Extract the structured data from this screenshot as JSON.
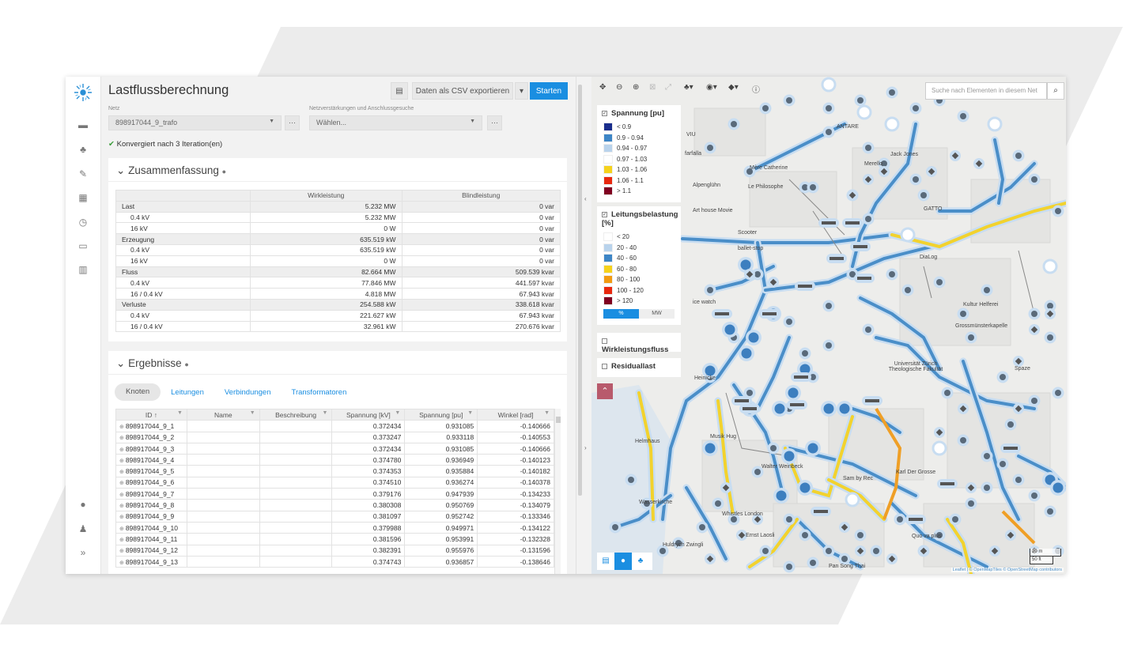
{
  "app": {
    "title": "Lastflussberechnung"
  },
  "toolbar": {
    "export_label": "Daten als CSV exportieren",
    "start_label": "Starten"
  },
  "net": {
    "label": "Netz",
    "value": "898917044_9_trafo"
  },
  "reinforcement": {
    "label": "Netzverstärkungen und Anschlussgesuche",
    "placeholder": "Wählen..."
  },
  "status": {
    "text": "Konvergiert nach 3 Iteration(en)"
  },
  "summary": {
    "title": "Zusammenfassung",
    "headers": [
      "",
      "Wirkleistung",
      "Blindleistung"
    ],
    "rows": [
      {
        "label": "Last",
        "wirk": "5.232 MW",
        "blind": "0 var",
        "group": true
      },
      {
        "label": "0.4 kV",
        "wirk": "5.232 MW",
        "blind": "0 var"
      },
      {
        "label": "16 kV",
        "wirk": "0 W",
        "blind": "0 var"
      },
      {
        "label": "Erzeugung",
        "wirk": "635.519 kW",
        "blind": "0 var",
        "group": true
      },
      {
        "label": "0.4 kV",
        "wirk": "635.519 kW",
        "blind": "0 var"
      },
      {
        "label": "16 kV",
        "wirk": "0 W",
        "blind": "0 var"
      },
      {
        "label": "Fluss",
        "wirk": "82.664 MW",
        "blind": "509.539 kvar",
        "group": true
      },
      {
        "label": "0.4 kV",
        "wirk": "77.846 MW",
        "blind": "441.597 kvar"
      },
      {
        "label": "16 / 0.4 kV",
        "wirk": "4.818 MW",
        "blind": "67.943 kvar"
      },
      {
        "label": "Verluste",
        "wirk": "254.588 kW",
        "blind": "338.618 kvar",
        "group": true
      },
      {
        "label": "0.4 kV",
        "wirk": "221.627 kW",
        "blind": "67.943 kvar"
      },
      {
        "label": "16 / 0.4 kV",
        "wirk": "32.961 kW",
        "blind": "270.676 kvar"
      }
    ]
  },
  "results": {
    "title": "Ergebnisse",
    "tabs": [
      "Knoten",
      "Leitungen",
      "Verbindungen",
      "Transformatoren"
    ],
    "headers": [
      "ID",
      "Name",
      "Beschreibung",
      "Spannung [kV]",
      "Spannung [pu]",
      "Winkel [rad]"
    ],
    "sort_icon": "↑",
    "rows": [
      {
        "id": "898917044_9_1",
        "kv": "0.372434",
        "pu": "0.931085",
        "rad": "-0.140666"
      },
      {
        "id": "898917044_9_2",
        "kv": "0.373247",
        "pu": "0.933118",
        "rad": "-0.140553"
      },
      {
        "id": "898917044_9_3",
        "kv": "0.372434",
        "pu": "0.931085",
        "rad": "-0.140666"
      },
      {
        "id": "898917044_9_4",
        "kv": "0.374780",
        "pu": "0.936949",
        "rad": "-0.140123"
      },
      {
        "id": "898917044_9_5",
        "kv": "0.374353",
        "pu": "0.935884",
        "rad": "-0.140182"
      },
      {
        "id": "898917044_9_6",
        "kv": "0.374510",
        "pu": "0.936274",
        "rad": "-0.140378"
      },
      {
        "id": "898917044_9_7",
        "kv": "0.379176",
        "pu": "0.947939",
        "rad": "-0.134233"
      },
      {
        "id": "898917044_9_8",
        "kv": "0.380308",
        "pu": "0.950769",
        "rad": "-0.134079"
      },
      {
        "id": "898917044_9_9",
        "kv": "0.381097",
        "pu": "0.952742",
        "rad": "-0.133346"
      },
      {
        "id": "898917044_9_10",
        "kv": "0.379988",
        "pu": "0.949971",
        "rad": "-0.134122"
      },
      {
        "id": "898917044_9_11",
        "kv": "0.381596",
        "pu": "0.953991",
        "rad": "-0.132328"
      },
      {
        "id": "898917044_9_12",
        "kv": "0.382391",
        "pu": "0.955976",
        "rad": "-0.131596"
      },
      {
        "id": "898917044_9_13",
        "kv": "0.374743",
        "pu": "0.936857",
        "rad": "-0.138646"
      }
    ]
  },
  "map": {
    "search_placeholder": "Suche nach Elementen in diesem Net",
    "legend_voltage": {
      "title": "Spannung [pu]",
      "items": [
        {
          "label": "< 0.9",
          "color": "#1a2d8c"
        },
        {
          "label": "0.9 - 0.94",
          "color": "#3d85c6"
        },
        {
          "label": "0.94 - 0.97",
          "color": "#b9d3ec"
        },
        {
          "label": "0.97 - 1.03",
          "color": "#ffffff"
        },
        {
          "label": "1.03 - 1.06",
          "color": "#f5d21c"
        },
        {
          "label": "1.06 - 1.1",
          "color": "#e8280f"
        },
        {
          "label": "> 1.1",
          "color": "#800020"
        }
      ]
    },
    "legend_load": {
      "title": "Leitungsbelastung [%]",
      "items": [
        {
          "label": "< 20",
          "color": "#ffffff"
        },
        {
          "label": "20 - 40",
          "color": "#b9d3ec"
        },
        {
          "label": "40 - 60",
          "color": "#3d85c6"
        },
        {
          "label": "60 - 80",
          "color": "#f5d21c"
        },
        {
          "label": "80 - 100",
          "color": "#f29b11"
        },
        {
          "label": "100 - 120",
          "color": "#e8280f"
        },
        {
          "label": "> 120",
          "color": "#800020"
        }
      ],
      "unit_pct": "%",
      "unit_mw": "MW"
    },
    "toggle_active_power": "Wirkleistungsfluss",
    "toggle_residual": "Residuallast",
    "labels": [
      "Mère Catherine",
      "Le Philosophe",
      "Alpenglühn",
      "Art house Movie",
      "Scooter",
      "ANTARE",
      "Merello",
      "Jack Jones",
      "GATTO",
      "DiaLog",
      "VIU",
      "farfalla",
      "ballet-stop",
      "ice watch",
      "Heinicke",
      "Helmhaus",
      "Musik Hug",
      "Walter Weinbeck",
      "Wasserkirche",
      "Whistles London",
      "Ernst Laosli",
      "Huldrych Zwingli",
      "Karl Der Grosse",
      "Kultur Helferei",
      "Grossmünsterkapelle",
      "Universität Zürich Theologische Fakultät",
      "Spaze",
      "Sam by Rec",
      "Quo va plus",
      "Pan Song Thai"
    ],
    "scale_m": "20 m",
    "scale_ft": "50 ft",
    "attribution": "Leaflet | © OpenMapTiles © OpenStreetMap contributors",
    "colors": {
      "line_blue": "#4a8ec8",
      "line_yellow": "#f2d22e",
      "line_orange": "#ef9f26",
      "node_halo": "#c8ddf1",
      "node_blue": "#3d7fbf"
    }
  }
}
